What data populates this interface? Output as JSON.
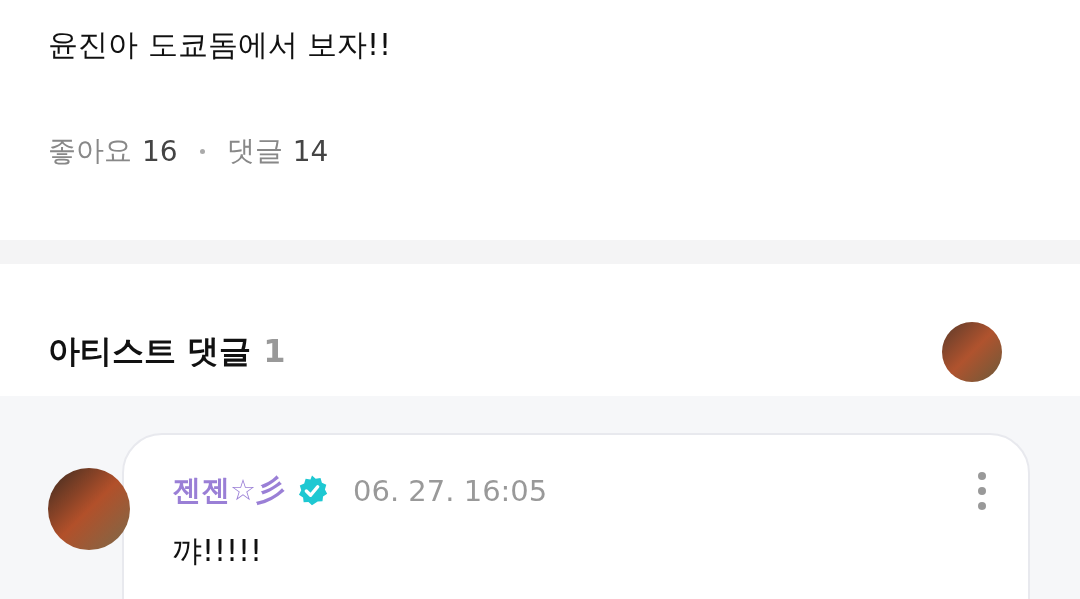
{
  "post": {
    "text": "윤진아 도쿄돔에서 보자!!",
    "likes_label": "좋아요",
    "likes_count": "16",
    "comments_label": "댓글",
    "comments_count": "14"
  },
  "artist_comments": {
    "title": "아티스트 댓글",
    "count": "1",
    "comments": [
      {
        "author": "젠젠☆彡",
        "verified": true,
        "time": "06. 27. 16:05",
        "text": "꺄!!!!!"
      }
    ]
  }
}
